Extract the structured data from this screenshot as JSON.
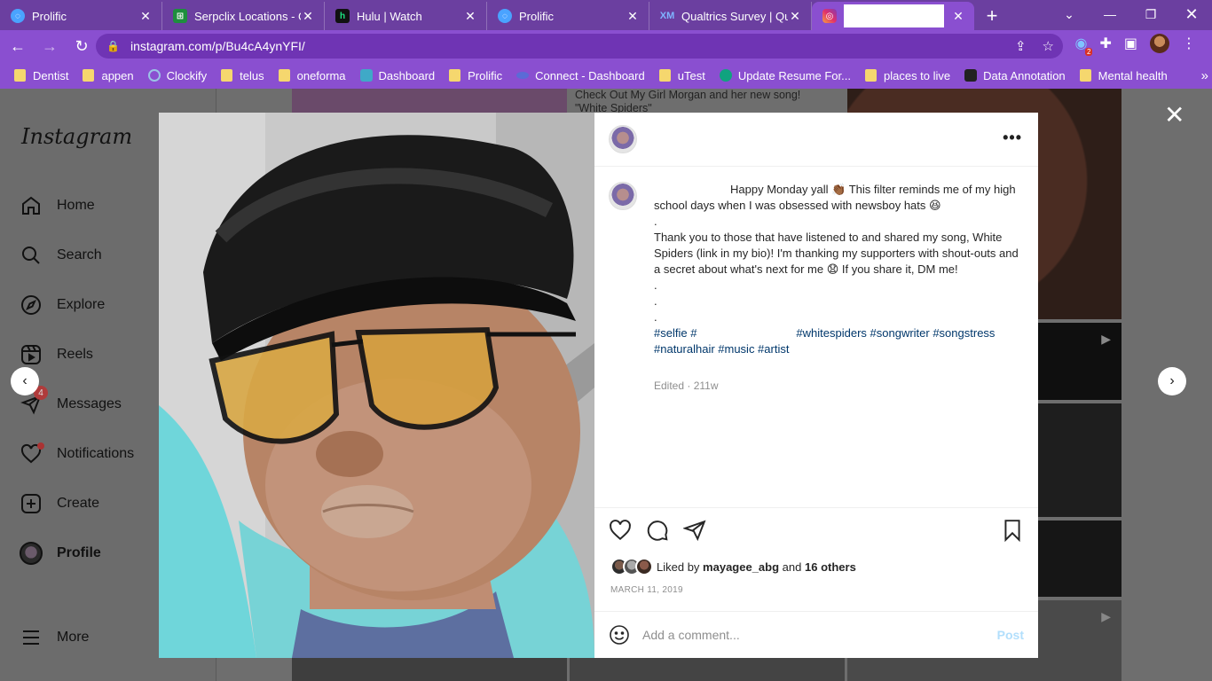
{
  "browser": {
    "tabs": [
      {
        "title": "Prolific",
        "icon": "prolific-icon",
        "color": "#4aa3ff"
      },
      {
        "title": "Serpclix Locations - Go",
        "icon": "sheets-icon",
        "color": "#1e8e3e"
      },
      {
        "title": "Hulu | Watch",
        "icon": "hulu-icon",
        "color": "#1ce783"
      },
      {
        "title": "Prolific",
        "icon": "prolific-icon",
        "color": "#4aa3ff"
      },
      {
        "title": "Qualtrics Survey | Qua",
        "icon": "qualtrics-icon",
        "color": "#2c7be5"
      },
      {
        "title": "",
        "icon": "instagram-icon",
        "color": "#e1306c",
        "active": true
      }
    ],
    "url": "instagram.com/p/Bu4cA4ynYFI/",
    "extension_badge": "2",
    "bookmarks": [
      {
        "label": "Dentist",
        "type": "folder"
      },
      {
        "label": "appen",
        "type": "folder"
      },
      {
        "label": "Clockify",
        "type": "site",
        "color": "#03a9f4"
      },
      {
        "label": "telus",
        "type": "folder"
      },
      {
        "label": "oneforma",
        "type": "folder"
      },
      {
        "label": "Dashboard",
        "type": "site",
        "color": "#3fa9c7"
      },
      {
        "label": "Prolific",
        "type": "folder"
      },
      {
        "label": "Connect - Dashboard",
        "type": "site",
        "color": "#5b6bd6"
      },
      {
        "label": "uTest",
        "type": "folder"
      },
      {
        "label": "Update Resume For...",
        "type": "site",
        "color": "#10a37f"
      },
      {
        "label": "places to live",
        "type": "folder"
      },
      {
        "label": "Data Annotation",
        "type": "site",
        "color": "#222222"
      },
      {
        "label": "Mental health",
        "type": "folder"
      }
    ],
    "bookmarks_more": "»"
  },
  "instagram": {
    "logo": "Instagram",
    "nav": [
      {
        "label": "Home",
        "icon": "home-icon"
      },
      {
        "label": "Search",
        "icon": "search-icon"
      },
      {
        "label": "Explore",
        "icon": "explore-icon"
      },
      {
        "label": "Reels",
        "icon": "reels-icon"
      },
      {
        "label": "Messages",
        "icon": "messages-icon",
        "badge": "4"
      },
      {
        "label": "Notifications",
        "icon": "heart-icon"
      },
      {
        "label": "Create",
        "icon": "create-icon"
      },
      {
        "label": "Profile",
        "icon": "profile-avatar"
      }
    ],
    "more_label": "More",
    "background_post_text": "Check Out My Girl Morgan and her new song!\n\"White Spiders\""
  },
  "modal": {
    "caption_text": "Happy Monday yall 👏🏾 This filter reminds me of my high school days when I was obsessed with newsboy hats 😆\n.\nThank you to those that have listened to and shared my song, White Spiders (link in my bio)! I'm thanking my supporters with shout-outs and a secret about what's next for me 😧 If you share it, DM me!\n.\n.\n.",
    "hashtags_1": "#selfie #",
    "hashtags_2": "#whitespiders #songwriter #songstress",
    "hashtags_3": "#naturalhair #music #artist",
    "meta": "Edited · 211w",
    "liked_by_prefix": "Liked by",
    "liked_by_user": "mayagee_abg",
    "liked_by_and": "and",
    "liked_by_others": "16 others",
    "date": "MARCH 11, 2019",
    "comment_placeholder": "Add a comment...",
    "post_label": "Post",
    "more_options": "•••"
  }
}
